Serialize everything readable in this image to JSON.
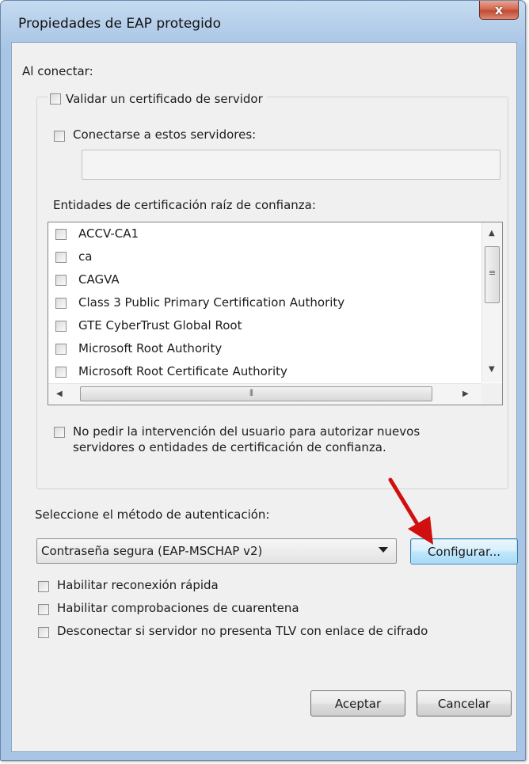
{
  "window": {
    "title": "Propiedades de EAP protegido",
    "close_label": "x"
  },
  "connect": {
    "heading": "Al conectar:",
    "validate_cert_label": "Validar un certificado de servidor",
    "connect_servers_label": "Conectarse a estos servidores:",
    "servers_value": "",
    "trusted_ca_heading": "Entidades de certificación raíz de confianza:",
    "ca_list": [
      {
        "label": "ACCV-CA1",
        "checked": false
      },
      {
        "label": "ca",
        "checked": false
      },
      {
        "label": "CAGVA",
        "checked": false
      },
      {
        "label": "Class 3 Public Primary Certification Authority",
        "checked": false
      },
      {
        "label": "GTE CyberTrust Global Root",
        "checked": false
      },
      {
        "label": "Microsoft Root Authority",
        "checked": false
      },
      {
        "label": "Microsoft Root Certificate Authority",
        "checked": false
      }
    ],
    "no_prompt_label": "No pedir la intervención del usuario para autorizar nuevos servidores o entidades de certificación de confianza."
  },
  "auth": {
    "heading": "Seleccione el método de autenticación:",
    "method_selected": "Contraseña segura (EAP-MSCHAP v2)",
    "configure_label": "Configurar...",
    "options": [
      {
        "label": "Habilitar reconexión rápida",
        "checked": false
      },
      {
        "label": "Habilitar comprobaciones de cuarentena",
        "checked": false
      },
      {
        "label": "Desconectar si servidor no presenta TLV con enlace de cifrado",
        "checked": false
      }
    ]
  },
  "footer": {
    "ok_label": "Aceptar",
    "cancel_label": "Cancelar"
  },
  "colors": {
    "annotation_arrow": "#d01010",
    "titlebar": "#b6cfea",
    "client_bg": "#f0f0f0"
  }
}
